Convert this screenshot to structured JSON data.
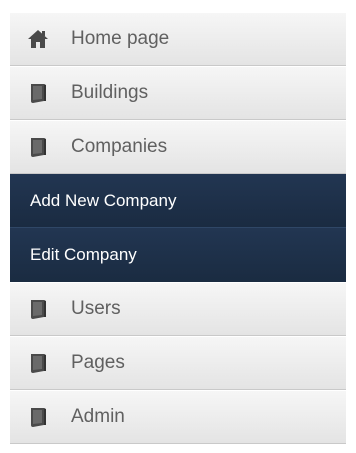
{
  "menu": {
    "items": [
      {
        "label": "Home page",
        "icon": "home-icon"
      },
      {
        "label": "Buildings",
        "icon": "book-icon"
      },
      {
        "label": "Companies",
        "icon": "book-icon"
      },
      {
        "label": "Users",
        "icon": "book-icon"
      },
      {
        "label": "Pages",
        "icon": "book-icon"
      },
      {
        "label": "Admin",
        "icon": "book-icon"
      }
    ],
    "companies_submenu": [
      {
        "label": "Add New Company"
      },
      {
        "label": "Edit Company"
      }
    ]
  },
  "colors": {
    "item_text": "#606060",
    "submenu_bg": "#1c2e45",
    "submenu_text": "#ffffff",
    "icon": "#4a4a4a"
  }
}
